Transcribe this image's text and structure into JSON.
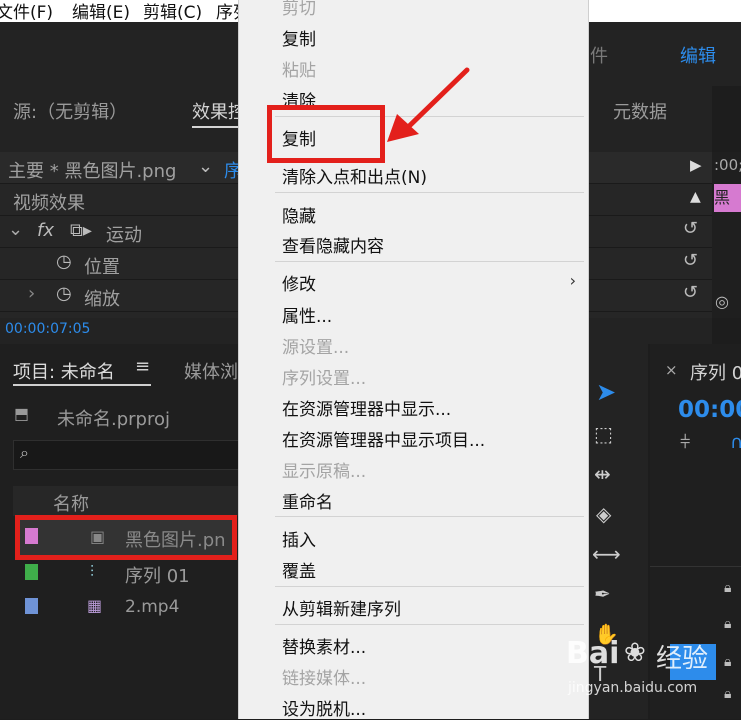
{
  "menubar": {
    "file": "文件(F)",
    "edit": "编辑(E)",
    "clip": "剪辑(C)",
    "seq": "序列"
  },
  "workspace": {
    "item1": "件",
    "item2": "编辑"
  },
  "source_panel": {
    "source_tab": "源:（无剪辑）",
    "effects_tab": "效果控",
    "metadata_tab": "元数据"
  },
  "effects": {
    "header": "主要 * 黑色图片.png",
    "seq_label": "序",
    "timecode_right": ":00;",
    "video_effects": "视频效果",
    "motion": "运动",
    "position": "位置",
    "scale": "缩放",
    "fx": "fx",
    "clip_name": "黑"
  },
  "timecode": "00:00:07:05",
  "project": {
    "title": "项目: 未命名",
    "media_tab": "媒体浏",
    "file": "未命名.prproj",
    "col_name": "名称",
    "items": [
      {
        "name": "黑色图片.pn",
        "color": "#d67ad0"
      },
      {
        "name": "序列 01",
        "color": "#3fae4a"
      },
      {
        "name": "2.mp4",
        "color": "#6f93d6"
      }
    ]
  },
  "sequence": {
    "tab": "序列 0",
    "timecode": "00:00"
  },
  "context_menu": {
    "items": [
      {
        "label": "剪切",
        "disabled": true
      },
      {
        "label": "复制",
        "disabled": false
      },
      {
        "label": "粘贴",
        "disabled": true
      },
      {
        "label": "清除",
        "disabled": false
      },
      {
        "label": "复制",
        "disabled": false
      },
      {
        "label": "清除入点和出点(N)",
        "disabled": false
      },
      {
        "label": "隐藏",
        "disabled": false
      },
      {
        "label": "查看隐藏内容",
        "disabled": false
      },
      {
        "label": "修改",
        "disabled": false
      },
      {
        "label": "属性...",
        "disabled": false
      },
      {
        "label": "源设置...",
        "disabled": true
      },
      {
        "label": "序列设置...",
        "disabled": true
      },
      {
        "label": "在资源管理器中显示...",
        "disabled": false
      },
      {
        "label": "在资源管理器中显示项目...",
        "disabled": false
      },
      {
        "label": "显示原稿...",
        "disabled": true
      },
      {
        "label": "重命名",
        "disabled": false
      },
      {
        "label": "插入",
        "disabled": false
      },
      {
        "label": "覆盖",
        "disabled": false
      },
      {
        "label": "从剪辑新建序列",
        "disabled": false
      },
      {
        "label": "替换素材...",
        "disabled": false
      },
      {
        "label": "链接媒体...",
        "disabled": true
      },
      {
        "label": "设为脱机...",
        "disabled": false
      }
    ]
  },
  "watermark": {
    "brand": "Bai",
    "brand2": "经验",
    "url": "jingyan.baidu.com"
  },
  "colors": {
    "accent": "#2d8ceb",
    "annotation": "#e3201b",
    "menu_bg": "#f0f0f0"
  }
}
